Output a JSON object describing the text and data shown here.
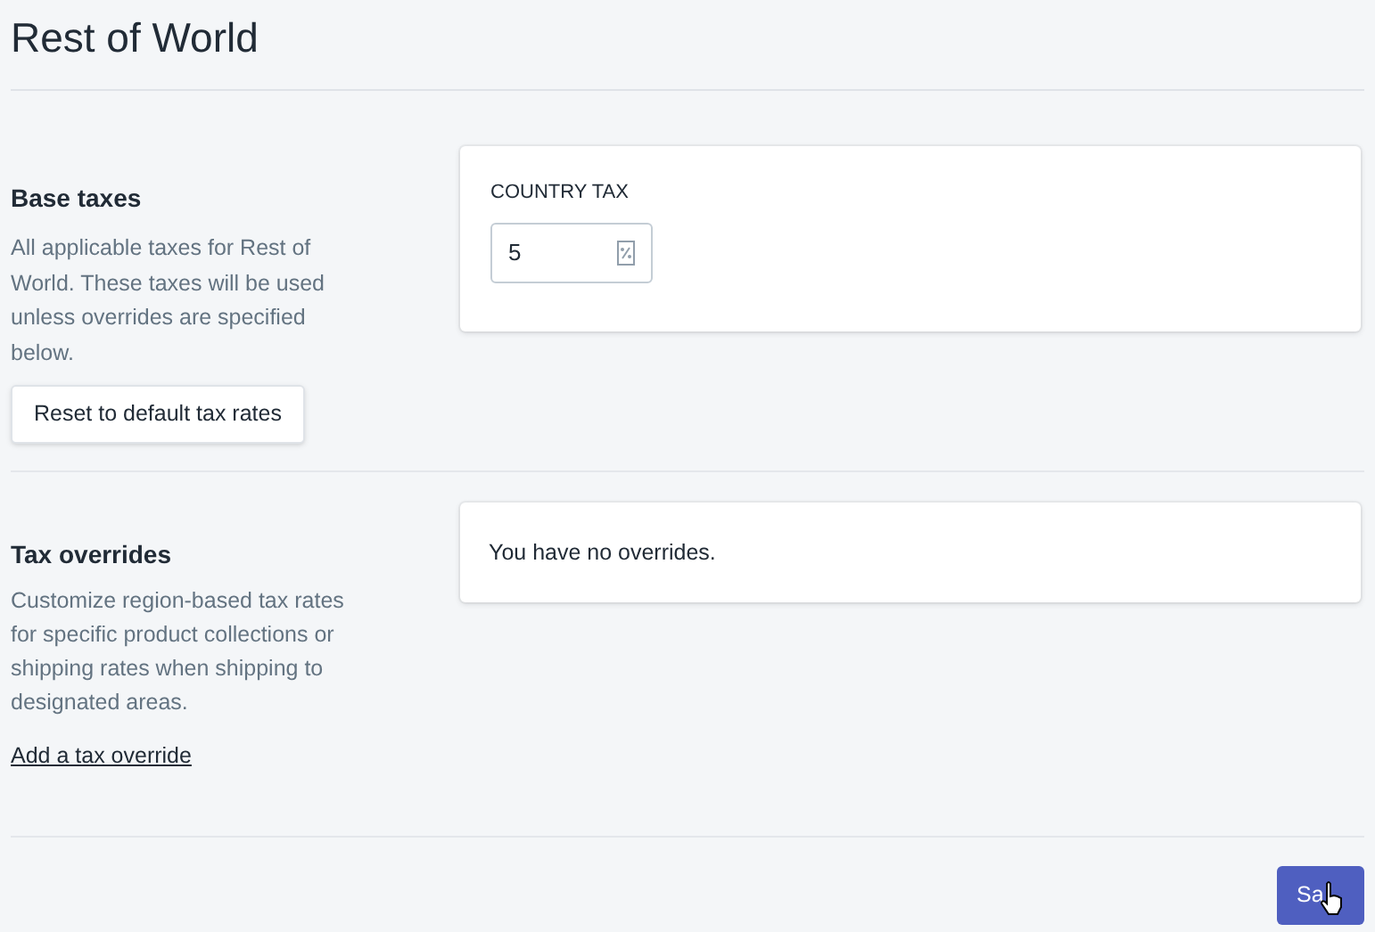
{
  "page": {
    "title": "Rest of World"
  },
  "base_taxes": {
    "heading": "Base taxes",
    "description": "All applicable taxes for Rest of World. These taxes will be used unless overrides are specified below.",
    "reset_button": "Reset to default tax rates",
    "card": {
      "label": "COUNTRY TAX",
      "value": "5"
    }
  },
  "tax_overrides": {
    "heading": "Tax overrides",
    "description": "Customize region-based tax rates for specific product collections or shipping rates when shipping to designated areas.",
    "link": "Add a tax override",
    "empty_message": "You have no overrides."
  },
  "save_button": {
    "label": "Sa"
  }
}
